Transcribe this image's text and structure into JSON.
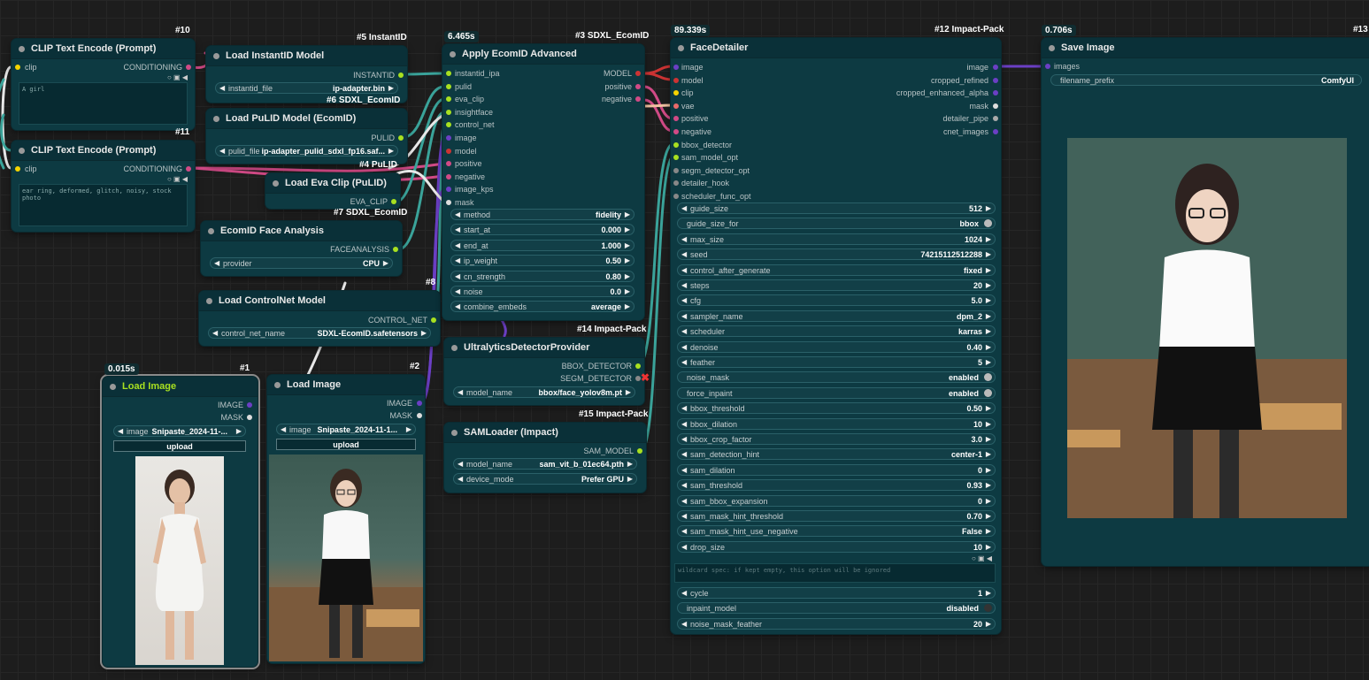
{
  "nodes": {
    "clip1": {
      "id": "#10",
      "title": "CLIP Text Encode (Prompt)",
      "in": "clip",
      "out": "CONDITIONING",
      "text": "A girl"
    },
    "clip2": {
      "id": "#11",
      "title": "CLIP Text Encode (Prompt)",
      "in": "clip",
      "out": "CONDITIONING",
      "text": "ear ring, deformed, glitch, noisy, stock photo"
    },
    "instantid": {
      "id": "#5 InstantID",
      "title": "Load InstantID Model",
      "out": "INSTANTID",
      "w_label": "instantid_file",
      "w_value": "ip-adapter.bin"
    },
    "pulid": {
      "id": "#6 SDXL_EcomID",
      "title": "Load PuLID Model (EcomID)",
      "out": "PULID",
      "w_label": "pulid_file",
      "w_value": "ip-adapter_pulid_sdxl_fp16.saf..."
    },
    "eva": {
      "id": "#4 PuLID",
      "title": "Load Eva Clip (PuLID)",
      "out": "EVA_CLIP"
    },
    "face": {
      "id": "#7 SDXL_EcomID",
      "title": "EcomID Face Analysis",
      "out": "FACEANALYSIS",
      "w_label": "provider",
      "w_value": "CPU"
    },
    "controlnet": {
      "id": "#8",
      "title": "Load ControlNet Model",
      "out": "CONTROL_NET",
      "w_label": "control_net_name",
      "w_value": "SDXL-EcomID.safetensors"
    },
    "load1": {
      "id": "#1",
      "time": "0.015s",
      "title": "Load Image",
      "outs": [
        "IMAGE",
        "MASK"
      ],
      "w_label": "image",
      "w_value": "Snipaste_2024-11-...",
      "upload": "upload"
    },
    "load2": {
      "id": "#2",
      "title": "Load Image",
      "outs": [
        "IMAGE",
        "MASK"
      ],
      "w_label": "image",
      "w_value": "Snipaste_2024-11-1...",
      "upload": "upload"
    },
    "apply": {
      "id": "#3 SDXL_EcomID",
      "time": "6.465s",
      "title": "Apply EcomID Advanced",
      "ins": [
        "instantid_ipa",
        "pulid",
        "eva_clip",
        "insightface",
        "control_net",
        "image",
        "model",
        "positive",
        "negative",
        "image_kps",
        "mask"
      ],
      "outs": [
        "MODEL",
        "positive",
        "negative"
      ],
      "widgets": [
        [
          "method",
          "fidelity"
        ],
        [
          "start_at",
          "0.000"
        ],
        [
          "end_at",
          "1.000"
        ],
        [
          "ip_weight",
          "0.50"
        ],
        [
          "cn_strength",
          "0.80"
        ],
        [
          "noise",
          "0.0"
        ],
        [
          "combine_embeds",
          "average"
        ]
      ]
    },
    "ultra": {
      "id": "#14 Impact-Pack",
      "title": "UltralyticsDetectorProvider",
      "outs": [
        "BBOX_DETECTOR",
        "SEGM_DETECTOR"
      ],
      "w_label": "model_name",
      "w_value": "bbox/face_yolov8m.pt"
    },
    "sam": {
      "id": "#15 Impact-Pack",
      "title": "SAMLoader (Impact)",
      "out": "SAM_MODEL",
      "widgets": [
        [
          "model_name",
          "sam_vit_b_01ec64.pth"
        ],
        [
          "device_mode",
          "Prefer GPU"
        ]
      ]
    },
    "fd": {
      "id": "#12 Impact-Pack",
      "time": "89.339s",
      "title": "FaceDetailer",
      "ins": [
        "image",
        "model",
        "clip",
        "vae",
        "positive",
        "negative",
        "bbox_detector",
        "sam_model_opt",
        "segm_detector_opt",
        "detailer_hook",
        "scheduler_func_opt"
      ],
      "outs": [
        "image",
        "cropped_refined",
        "cropped_enhanced_alpha",
        "mask",
        "detailer_pipe",
        "cnet_images"
      ],
      "widgets": [
        [
          "guide_size",
          "512"
        ],
        [
          "guide_size_for",
          "bbox"
        ],
        [
          "max_size",
          "1024"
        ],
        [
          "seed",
          "742151125122​88"
        ],
        [
          "control_after_generate",
          "fixed"
        ],
        [
          "steps",
          "20"
        ],
        [
          "cfg",
          "5.0"
        ],
        [
          "sampler_name",
          "dpm_2"
        ],
        [
          "scheduler",
          "karras"
        ],
        [
          "denoise",
          "0.40"
        ],
        [
          "feather",
          "5"
        ],
        [
          "noise_mask",
          "enabled"
        ],
        [
          "force_inpaint",
          "enabled"
        ],
        [
          "bbox_threshold",
          "0.50"
        ],
        [
          "bbox_dilation",
          "10"
        ],
        [
          "bbox_crop_factor",
          "3.0"
        ],
        [
          "sam_detection_hint",
          "center-1"
        ],
        [
          "sam_dilation",
          "0"
        ],
        [
          "sam_threshold",
          "0.93"
        ],
        [
          "sam_bbox_expansion",
          "0"
        ],
        [
          "sam_mask_hint_threshold",
          "0.70"
        ],
        [
          "sam_mask_hint_use_negative",
          "False"
        ],
        [
          "drop_size",
          "10"
        ]
      ],
      "wildcard": "wildcard spec: if kept empty, this option will be ignored",
      "widgets2": [
        [
          "cycle",
          "1"
        ],
        [
          "inpaint_model",
          "disabled"
        ],
        [
          "noise_mask_feather",
          "20"
        ]
      ]
    },
    "save": {
      "id": "#13",
      "time": "0.706s",
      "title": "Save Image",
      "in": "images",
      "w_label": "filename_prefix",
      "w_value": "ComfyUI"
    }
  },
  "colors": {
    "node_bg": "#0d3a42",
    "canvas": "#1d1d1d",
    "link_teal": "#3aa39a",
    "link_pink": "#d14a86",
    "link_white": "#f0f0f0",
    "link_purple": "#6b3fc4",
    "link_red": "#c33"
  }
}
